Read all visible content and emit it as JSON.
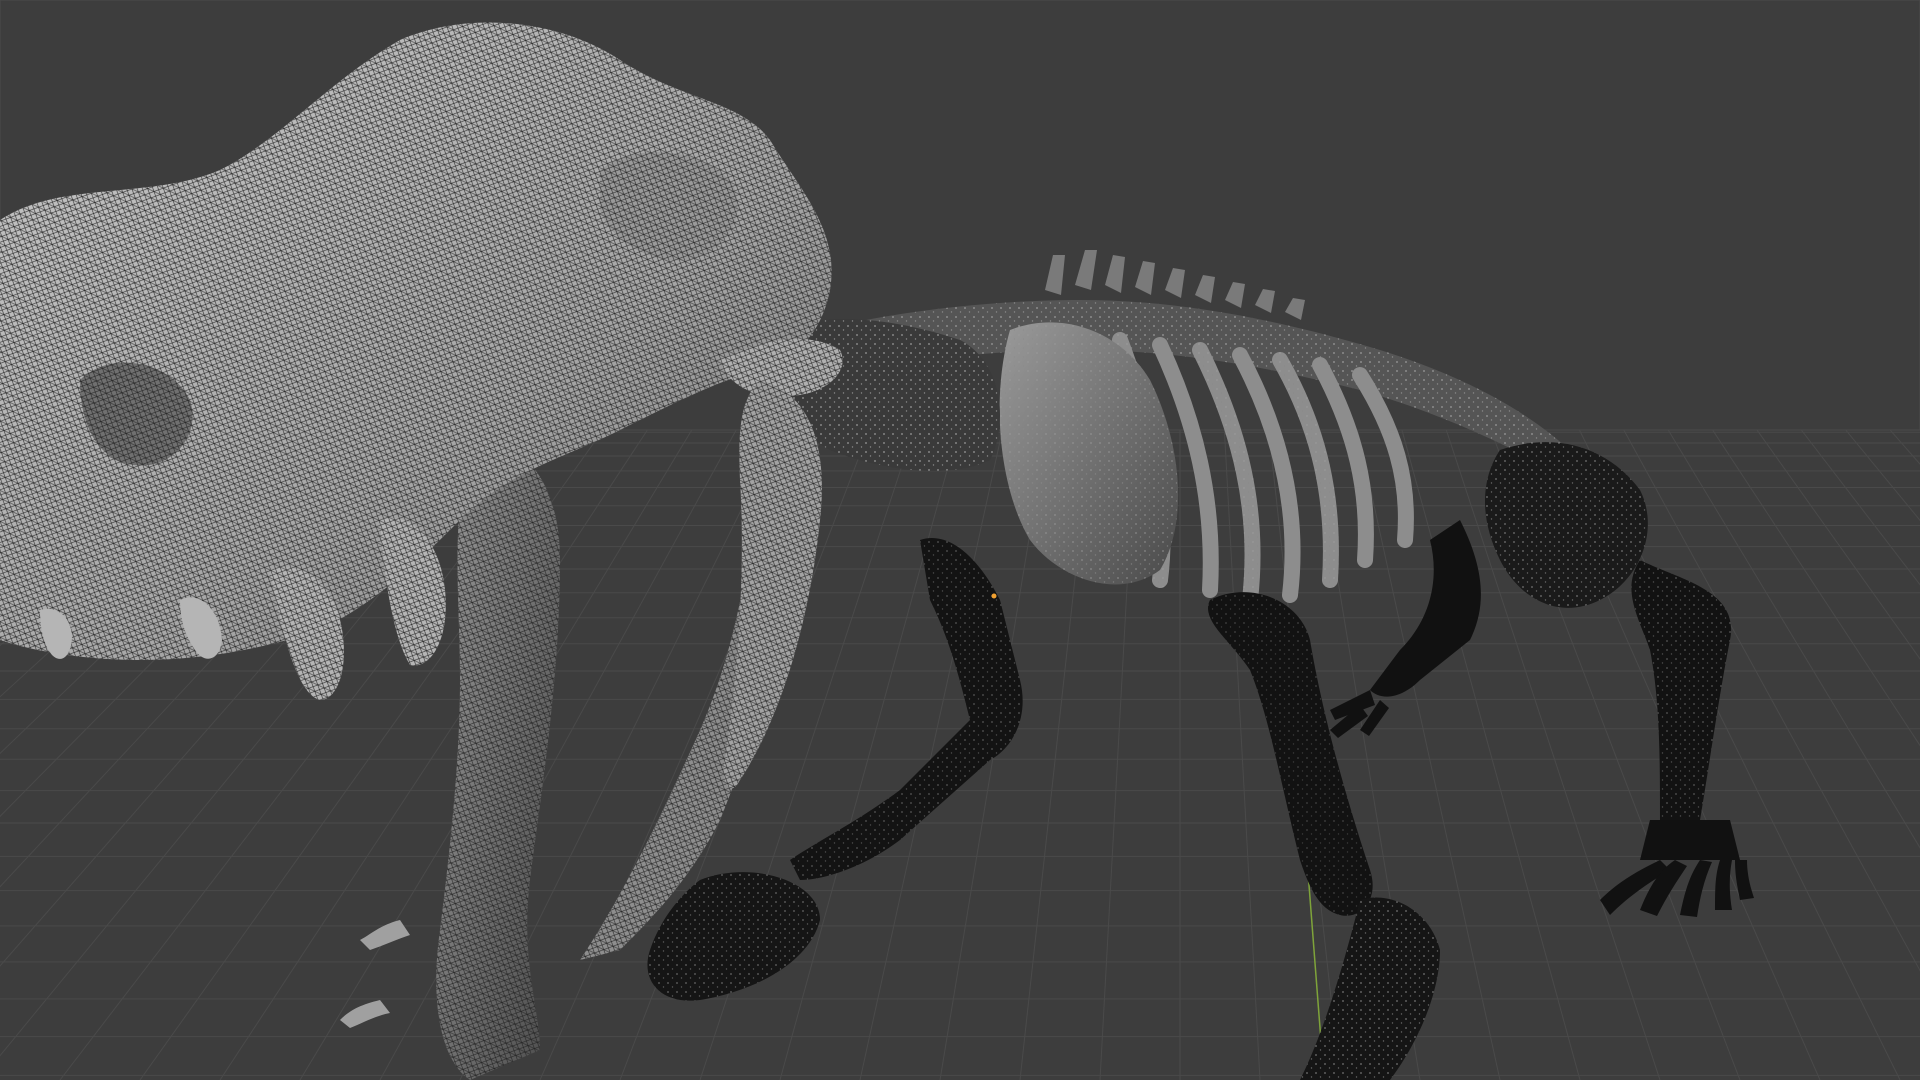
{
  "app": {
    "window_title": "",
    "mode": "3D Viewport",
    "shading": "wireframe-overlay",
    "background_color": "#3d3d3d",
    "grid_color": "#4a4a4a",
    "mesh_light_color": "#b9b9b9",
    "mesh_dark_color": "#111111",
    "y_axis_color": "#7fa43a"
  },
  "scene": {
    "object": "sabertooth-skeleton-mesh",
    "origin_marker_color": "#f0a030"
  }
}
